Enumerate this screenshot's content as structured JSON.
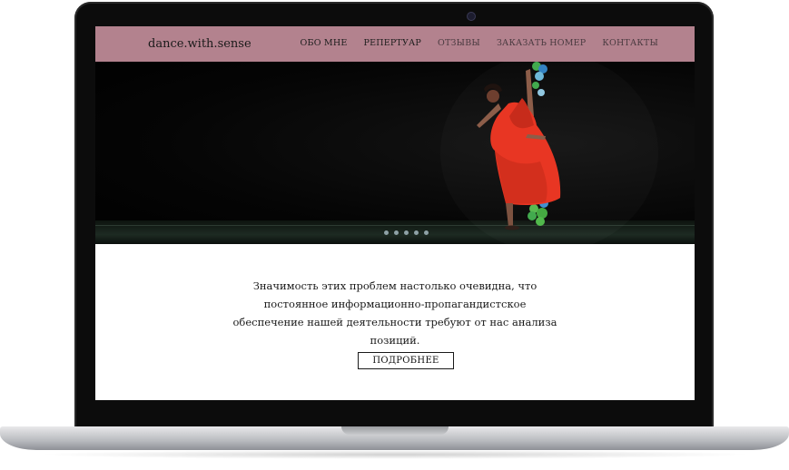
{
  "site": {
    "brand": "dance.with.sense"
  },
  "nav": {
    "items": [
      {
        "label": "ОБО МНЕ"
      },
      {
        "label": "РЕПЕРТУАР"
      },
      {
        "label": "ОТЗЫВЫ"
      },
      {
        "label": "ЗАКАЗАТЬ НОМЕР"
      },
      {
        "label": "КОНТАКТЫ"
      }
    ]
  },
  "hero": {
    "slides_count": 5,
    "active_slide": 1,
    "image": "dancer-in-red-dress"
  },
  "content": {
    "lead": "Значимость этих проблем настолько очевидна, что постоянное информационно-пропагандистское обеспечение нашей деятельности требуют от нас анализа позиций.",
    "button_label": "ПОДРОБНЕЕ"
  },
  "colors": {
    "navbar": "#b3828e",
    "hero_bg": "#000000",
    "dress": "#e8321e"
  }
}
